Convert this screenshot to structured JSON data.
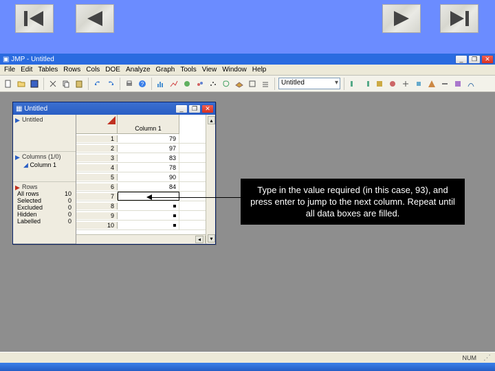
{
  "nav": {
    "first": "first",
    "prev": "prev",
    "next": "next",
    "last": "last"
  },
  "app": {
    "title": "JMP - Untitled",
    "menus": [
      "File",
      "Edit",
      "Tables",
      "Rows",
      "Cols",
      "DOE",
      "Analyze",
      "Graph",
      "Tools",
      "View",
      "Window",
      "Help"
    ],
    "combo_value": "Untitled"
  },
  "inner": {
    "title": "Untitled",
    "top_label": "Untitled",
    "columns_section": "Columns (1/0)",
    "column1": "Column 1",
    "rows_section": "Rows",
    "rowstats": [
      {
        "k": "All rows",
        "v": "10"
      },
      {
        "k": "Selected",
        "v": "0"
      },
      {
        "k": "Excluded",
        "v": "0"
      },
      {
        "k": "Hidden",
        "v": "0"
      },
      {
        "k": "Labelled",
        "v": "0"
      }
    ],
    "col_header": "Column 1",
    "rows": [
      {
        "n": "1",
        "v": "79"
      },
      {
        "n": "2",
        "v": "97"
      },
      {
        "n": "3",
        "v": "83"
      },
      {
        "n": "4",
        "v": "78"
      },
      {
        "n": "5",
        "v": "90"
      },
      {
        "n": "6",
        "v": "84"
      },
      {
        "n": "7",
        "v": "",
        "active": true
      },
      {
        "n": "8",
        "v": "",
        "dot": true
      },
      {
        "n": "9",
        "v": "",
        "dot": true
      },
      {
        "n": "10",
        "v": "",
        "dot": true
      }
    ]
  },
  "callout": "Type in the value required (in this case, 93), and press enter to jump to the next column. Repeat until all data boxes are filled.",
  "status_ready": "NUM"
}
